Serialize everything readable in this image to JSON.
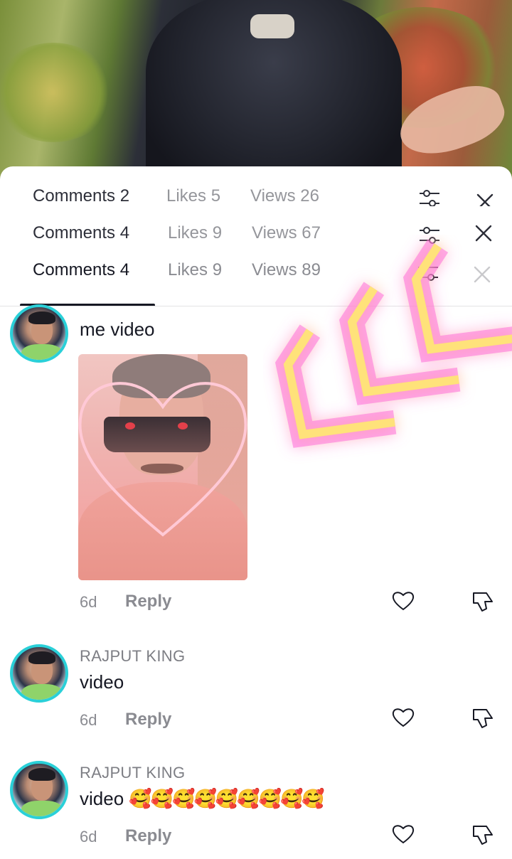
{
  "header": {
    "ghost_rows": [
      {
        "comments": "Comments 2",
        "likes": "Likes 5",
        "views": "Views 26"
      },
      {
        "comments": "Comments 4",
        "likes": "Likes 9",
        "views": "Views 67"
      }
    ],
    "tabs": {
      "comments": "Comments 4",
      "likes": "Likes 9",
      "views": "Views 89"
    },
    "active_tab": "comments"
  },
  "comments": [
    {
      "username": "",
      "text": "me video",
      "age": "6d",
      "reply_label": "Reply",
      "has_photo": true
    },
    {
      "username": "RAJPUT KING",
      "text": "video",
      "age": "6d",
      "reply_label": "Reply"
    },
    {
      "username": "RAJPUT KING",
      "text": "video",
      "emojis": "🥰🥰🥰🥰🥰🥰🥰🥰🥰",
      "age": "6d",
      "reply_label": "Reply"
    }
  ],
  "colors": {
    "avatar_ring": "#2ad0d8",
    "neon_glow": "#ff4fd8",
    "neon_core": "#ffe27a"
  },
  "icons": {
    "filter": "sliders-icon",
    "close": "close-icon",
    "like": "heart-outline-icon",
    "dislike": "thumbs-down-icon"
  }
}
